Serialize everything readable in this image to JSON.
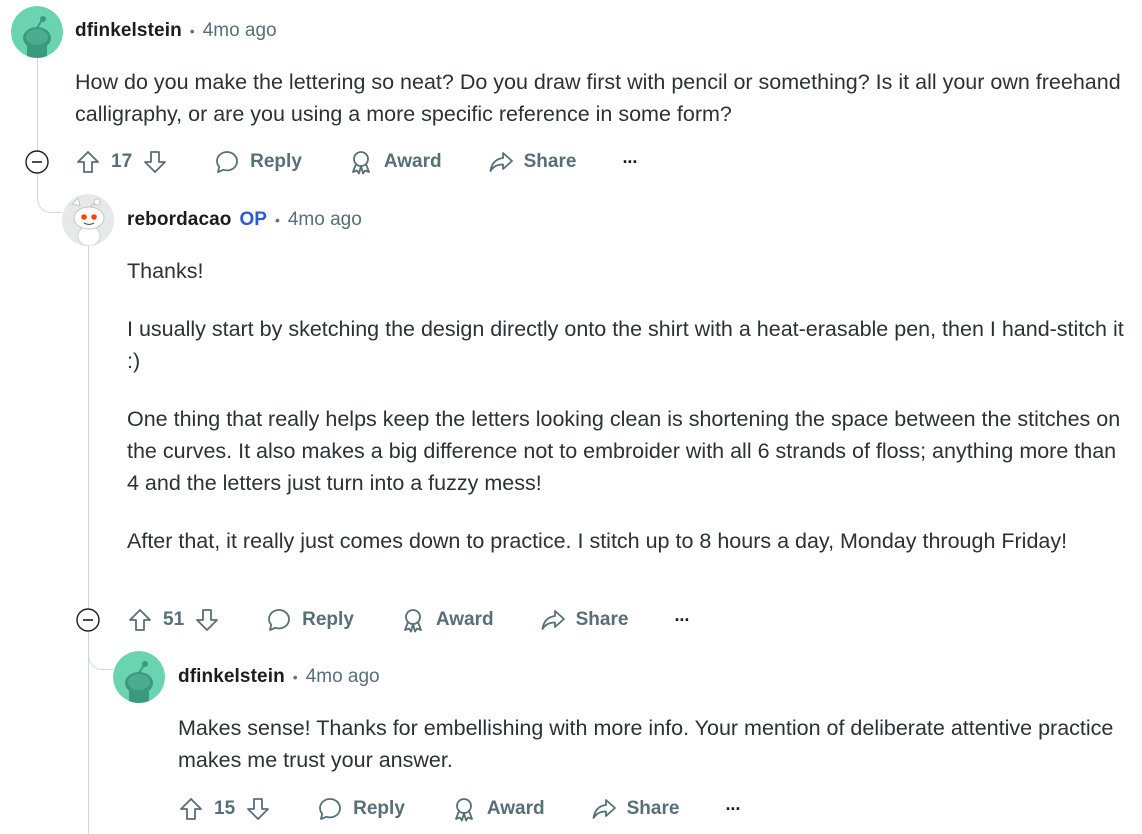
{
  "comments": [
    {
      "username": "dfinkelstein",
      "op": false,
      "time": "4mo ago",
      "paragraphs": [
        "How do you make the lettering so neat? Do you draw first with pencil or something? Is it all your own freehand calligraphy, or are you using a more specific reference in some form?"
      ],
      "score": "17",
      "avatar_color": "#6ad4b1"
    },
    {
      "username": "rebordacao",
      "op": true,
      "op_label": "OP",
      "time": "4mo ago",
      "paragraphs": [
        "Thanks!",
        "I usually start by sketching the design directly onto the shirt with a heat-erasable pen, then I hand-stitch it :)",
        "One thing that really helps keep the letters looking clean is shortening the space between the stitches on the curves. It also makes a big difference not to embroider with all 6 strands of floss; anything more than 4 and the letters just turn into a fuzzy mess!",
        "After that, it really just comes down to practice. I stitch up to 8 hours a day, Monday through Friday!"
      ],
      "score": "51",
      "avatar_color": "#e6e8ea"
    },
    {
      "username": "dfinkelstein",
      "op": false,
      "time": "4mo ago",
      "paragraphs": [
        "Makes sense! Thanks for embellishing with more info. Your mention of deliberate attentive practice makes me trust your answer."
      ],
      "score": "15",
      "avatar_color": "#6ad4b1"
    }
  ],
  "actions": {
    "reply": "Reply",
    "award": "Award",
    "share": "Share",
    "more": "···"
  },
  "separator": "•",
  "icons": {
    "upvote": "upvote-arrow-icon",
    "downvote": "downvote-arrow-icon",
    "reply": "speech-bubble-icon",
    "award": "award-ribbon-icon",
    "share": "share-arrow-icon",
    "collapse": "collapse-minus-icon"
  },
  "colors": {
    "meta_text": "#576f76",
    "op_blue": "#2a5bd7",
    "thread_line": "#d3d6da",
    "snoo_green": "#6ad4b1"
  }
}
